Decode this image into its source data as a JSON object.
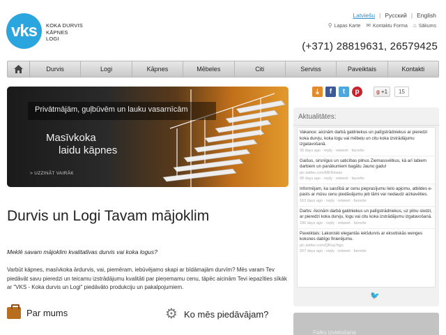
{
  "logo": {
    "letters": "VKS",
    "lines": [
      "KOKA DURVIS",
      "KĀPNES",
      "LOGI"
    ]
  },
  "languages": [
    {
      "label": "Latviešu",
      "active": true
    },
    {
      "label": "Русский",
      "active": false
    },
    {
      "label": "English",
      "active": false
    }
  ],
  "toplinks": [
    {
      "icon": "sitemap-icon",
      "label": "Lapas Karte"
    },
    {
      "icon": "contact-icon",
      "label": "Kontaktu Forma"
    },
    {
      "icon": "home-icon",
      "label": "Sākums"
    }
  ],
  "phone": "(+371) 28819631, 26579425",
  "nav": [
    "Durvis",
    "Logi",
    "Kāpnes",
    "Mēbeles",
    "Citi",
    "Serviss",
    "Paveiktais",
    "Kontakti"
  ],
  "banner": {
    "line1": "Privātmājām, guļbūvēm un lauku vasarnīcām",
    "line2a": "Masīvkoka",
    "line2b": "laidu kāpnes",
    "cta": "> UZZINĀT VAIRĀK"
  },
  "main": {
    "title": "Durvis un Logi Tavam mājoklim",
    "lead": "Meklē savam mājoklim kvalitatīvas durvis vai koka logus?",
    "body": "Varbūt kāpnes, masīvkoka ārdurvis, vai, piemēram, iebūvējamo skapi ar bīdāmajām durvīm? Mēs varam Tev piedāvāt savu pieredzi un teicamu izstrādājumu kvalitāti par pieņemamu cenu, tāpēc aicinām Tevi iepazīties sīkāk ar \"VKS - Koka durvis un Logi\" piedāvāto produkciju un pakalpojumiem.",
    "section1": "Par mums",
    "section2": "Ko mēs piedāvājam?"
  },
  "social": {
    "gplus_label": "+1",
    "gplus_count": "15"
  },
  "news": {
    "title": "Aktualitātes:",
    "tweets": [
      {
        "text": "Vakance: aicinām darbā galdniekus un palīgstrādniekus ar pieredzi koka durvju, koka logu vai mēbeļu un citu koka izstrādājumu izgatavošanā.",
        "meta": "36 days ago · reply · retweet · favorite"
      },
      {
        "text": "Gaišus, sirsnīgus un saticības pilnus Ziemassvētkus, kā arī labiem darbiem un panākumiem bagātu Jauno gadu!",
        "meta": "pic.twitter.com/MKNmwis",
        "meta2": "98 days ago · reply · retweet · favorite"
      },
      {
        "text": "Informējam, ka saistībā ar cenu pieprasījumu lielo apjomu, atbildes e-pasts ar mūsu cenu piedāvājumu jeb tāmi var nedaudz aizkavēties.",
        "meta": "163 days ago · reply · retweet · favorite"
      },
      {
        "text": "Darbs: Aicinām darbā galdniekus un palīgstrādniekus, uz pilnu slodzi, ar pieredzi koka durvju, logu vai citu koka izstrādājumu izgatavošanā.",
        "meta": "180 days ago · reply · retweet · favorite"
      },
      {
        "text": "Paveiktais: Lakoniski elegantās iekšdurvis ar eksotiskās wenges koksnes dabīgo finierējumu.",
        "meta": "pic.twitter.com/QRnq7tlgo",
        "meta2": "207 days ago · reply · retweet · favorite"
      }
    ]
  },
  "widget2": {
    "label": "Faiku izvietošana"
  },
  "colors": {
    "logo": "#2aa5dd",
    "link": "#2a8fcf"
  }
}
